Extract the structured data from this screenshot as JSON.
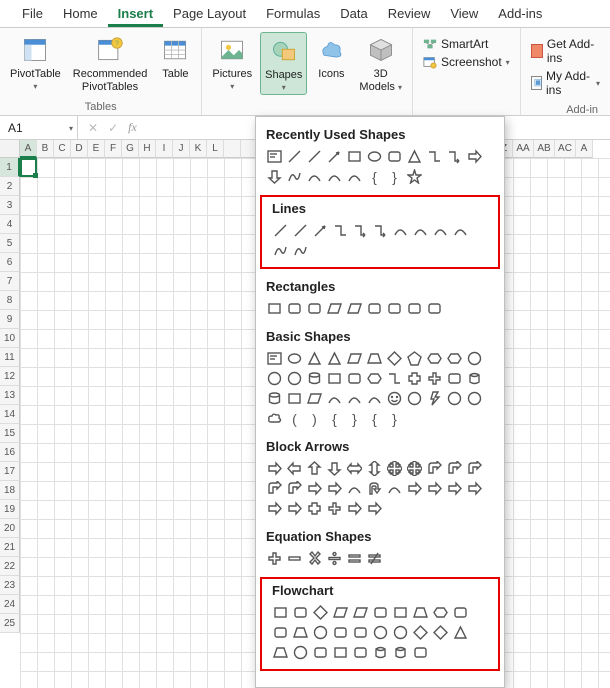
{
  "tabs": [
    "File",
    "Home",
    "Insert",
    "Page Layout",
    "Formulas",
    "Data",
    "Review",
    "View",
    "Add-ins"
  ],
  "active_tab": "Insert",
  "ribbon": {
    "tables": {
      "pivot": "PivotTable",
      "rec_l1": "Recommended",
      "rec_l2": "PivotTables",
      "table": "Table",
      "group": "Tables"
    },
    "illus": {
      "pictures": "Pictures",
      "shapes": "Shapes",
      "icons": "Icons",
      "models_l1": "3D",
      "models_l2": "Models"
    },
    "smart": {
      "smartart": "SmartArt",
      "screenshot": "Screenshot"
    },
    "addins": {
      "get": "Get Add-ins",
      "my": "My Add-ins",
      "group": "Add-in"
    }
  },
  "namebox": "A1",
  "columns": [
    "A",
    "B",
    "C",
    "D",
    "E",
    "F",
    "G",
    "H",
    "I",
    "J",
    "K",
    "L",
    "",
    "",
    "",
    "",
    "",
    "",
    "",
    "",
    "",
    "",
    "",
    "",
    "",
    "",
    "",
    "",
    "Z",
    "AA",
    "AB",
    "AC",
    "A"
  ],
  "rows": [
    "1",
    "2",
    "3",
    "4",
    "5",
    "6",
    "7",
    "8",
    "9",
    "10",
    "11",
    "12",
    "13",
    "14",
    "15",
    "16",
    "17",
    "18",
    "19",
    "20",
    "21",
    "22",
    "23",
    "24",
    "25"
  ],
  "drop": {
    "recent": "Recently Used Shapes",
    "lines": "Lines",
    "rects": "Rectangles",
    "basic": "Basic Shapes",
    "arrows": "Block Arrows",
    "eq": "Equation Shapes",
    "flow": "Flowchart"
  }
}
